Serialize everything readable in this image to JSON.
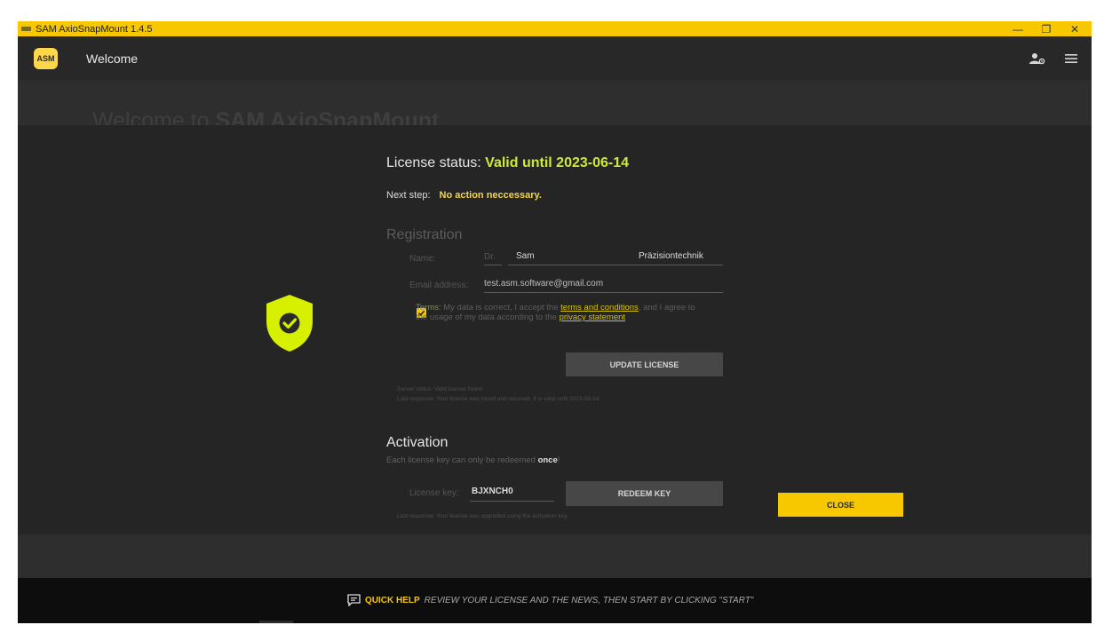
{
  "window": {
    "title": "SAM AxioSnapMount 1.4.5",
    "minimize": "—",
    "restore": "❐",
    "close": "✕"
  },
  "appbar": {
    "logo": "ASM",
    "page_title": "Welcome"
  },
  "background": {
    "heading_prefix": "Welcome to ",
    "heading_brand": "SAM AxioSnapMount"
  },
  "license": {
    "status_label": "License status: ",
    "status_value": "Valid until 2023-06-14",
    "next_step_label": "Next step:",
    "next_step_value": "No action neccessary."
  },
  "registration": {
    "heading": "Registration",
    "name_label": "Name:",
    "title_value": "Dr.",
    "first_name": "Sam",
    "last_name": "Präzisiontechnik",
    "email_label": "Email address:",
    "email_value": "test.asm.software@gmail.com",
    "terms_strong": "Terms:",
    "terms_text1": " My data is correct, I accept the ",
    "terms_link": "terms and conditions",
    "terms_text2": ", and I agree to",
    "terms_text3": "the usage of my data according to the ",
    "privacy_link": "privacy statement",
    "update_button": "UPDATE LICENSE",
    "server_status": "Server status: Valid license found",
    "last_response": "Last response: Your license was found and returned. It is valid until 2023-06-14."
  },
  "activation": {
    "heading": "Activation",
    "sub_text": "Each license key can only be redeemed ",
    "sub_bold": "once",
    "sub_end": "!",
    "key_label": "License key:",
    "key_value": "BJXNCH0",
    "redeem_button": "REDEEM KEY",
    "last_response": "Last response: Your license was upgraded using the activation key."
  },
  "dialog": {
    "close_button": "CLOSE"
  },
  "quick_help": {
    "label": "QUICK HELP",
    "message": "REVIEW YOUR LICENSE AND THE NEWS, THEN START BY CLICKING \"START\""
  },
  "colors": {
    "accent": "#f7c800",
    "valid": "#cfe83a",
    "panel": "#252525",
    "background": "#2e2e2e"
  }
}
